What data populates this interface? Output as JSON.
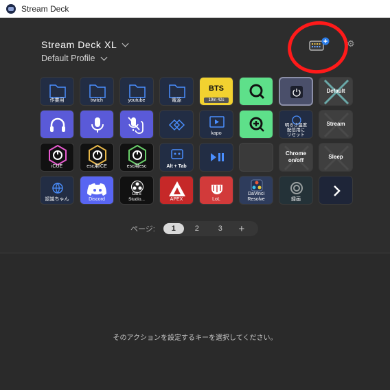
{
  "window": {
    "title": "Stream Deck"
  },
  "header": {
    "device_name": "Stream Deck XL",
    "profile_name": "Default Profile"
  },
  "keys": [
    {
      "id": "k1",
      "label": "作業用",
      "icon": "folder-icon"
    },
    {
      "id": "k2",
      "label": "twitch",
      "icon": "folder-icon"
    },
    {
      "id": "k3",
      "label": "youtube",
      "icon": "folder-icon"
    },
    {
      "id": "k4",
      "label": "電源",
      "icon": "folder-icon"
    },
    {
      "id": "k5",
      "label": "BTS",
      "sub": "19m 42s",
      "icon": "timer-icon"
    },
    {
      "id": "k6",
      "label": "",
      "icon": "magnifier-icon"
    },
    {
      "id": "k7",
      "label": "",
      "icon": "power-icon"
    },
    {
      "id": "k8",
      "label": "Default",
      "icon": "x-icon"
    },
    {
      "id": "k9",
      "label": "",
      "icon": "headphones-icon"
    },
    {
      "id": "k10",
      "label": "",
      "icon": "microphone-icon"
    },
    {
      "id": "k11",
      "label": "",
      "icon": "mic-muted-icon"
    },
    {
      "id": "k12",
      "label": "",
      "icon": "chevrons-icon"
    },
    {
      "id": "k13",
      "label": "kapo",
      "icon": "video-icon"
    },
    {
      "id": "k14",
      "label": "",
      "icon": "zoom-in-icon"
    },
    {
      "id": "k15",
      "label": "明るさ温度\n配信用に\nリセット",
      "icon": "reset-icon"
    },
    {
      "id": "k16",
      "label": "Stream",
      "icon": "x-icon"
    },
    {
      "id": "k17",
      "label": "iCUE",
      "icon": "icue-icon"
    },
    {
      "id": "k18",
      "label": "esc用ICE",
      "icon": "icue-icon"
    },
    {
      "id": "k19",
      "label": "esc用esc",
      "icon": "icue-icon"
    },
    {
      "id": "k20",
      "label": "Alt + Tab",
      "icon": "robot-icon"
    },
    {
      "id": "k21",
      "label": "",
      "icon": "play-pause-icon"
    },
    {
      "id": "k22",
      "label": "",
      "icon": "empty"
    },
    {
      "id": "k23",
      "label": "Chrome\non/off",
      "icon": "x-icon"
    },
    {
      "id": "k24",
      "label": "Sleep",
      "icon": "x-icon"
    },
    {
      "id": "k25",
      "label": "認識ちゃん",
      "icon": "globe-icon"
    },
    {
      "id": "k26",
      "label": "Discord",
      "icon": "discord-icon"
    },
    {
      "id": "k27",
      "label": "OBS\nStudio...",
      "icon": "obs-icon"
    },
    {
      "id": "k28",
      "label": "APEX",
      "icon": "apex-icon"
    },
    {
      "id": "k29",
      "label": "LoL",
      "icon": "lol-icon"
    },
    {
      "id": "k30",
      "label": "DaVinci\nResolve",
      "icon": "davinci-icon"
    },
    {
      "id": "k31",
      "label": "録画",
      "icon": "record-icon"
    },
    {
      "id": "k32",
      "label": "",
      "icon": "chevron-right-icon"
    }
  ],
  "pager": {
    "label": "ページ:",
    "pages": [
      "1",
      "2",
      "3"
    ],
    "current": "1",
    "add": "+"
  },
  "bottom": {
    "hint": "そのアクションを設定するキーを選択してください。"
  },
  "colors": {
    "annotation": "#ff1a1a",
    "accent": "#2b7de9"
  }
}
